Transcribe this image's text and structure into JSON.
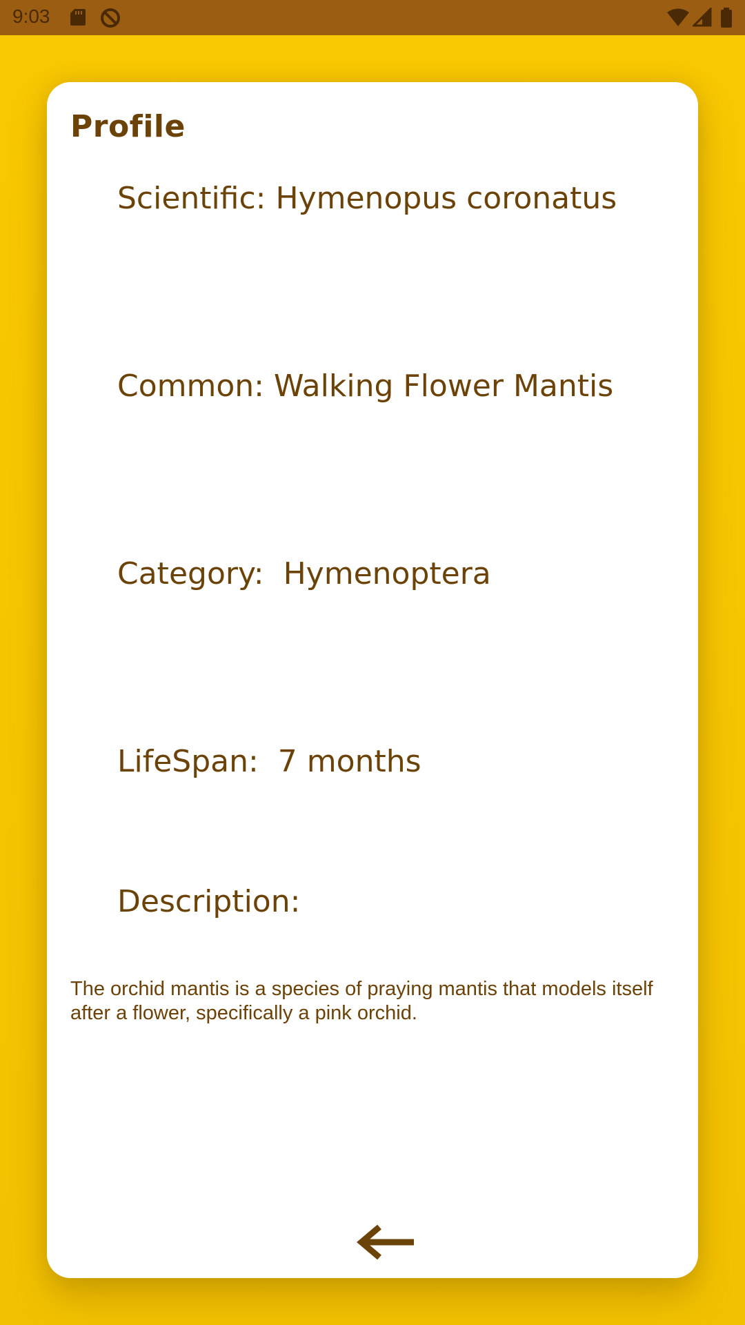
{
  "status_bar": {
    "time": "9:03",
    "icons": [
      "sd-card-icon",
      "do-not-disturb-icon",
      "wifi-icon",
      "signal-icon",
      "battery-icon"
    ]
  },
  "colors": {
    "background": "#F8C800",
    "status_bar": "#9A5D12",
    "card": "#FFFFFF",
    "text": "#6B4208"
  },
  "profile": {
    "title": "Profile",
    "scientific": "Scientific: Hymenopus coronatus",
    "common": "Common: Walking Flower Mantis",
    "category": "Category:  Hymenoptera",
    "lifespan": "LifeSpan:  7 months",
    "description_label": "Description:",
    "description": "The orchid mantis is a species of praying mantis that models itself after a flower, specifically a pink orchid."
  },
  "navigation": {
    "back_icon": "arrow-left-icon"
  }
}
